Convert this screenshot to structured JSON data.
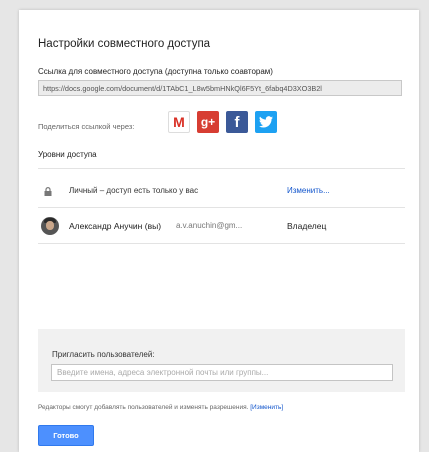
{
  "dialog": {
    "title": "Настройки совместного доступа",
    "link_label": "Ссылка для совместного доступа (доступна только соавторам)",
    "link_value": "https://docs.google.com/document/d/1TAbC1_L8w5bmHNkQl6F5Yt_6fabq4D3XO3B2l",
    "share_via_label": "Поделиться ссылкой через:",
    "share_icons": [
      "gmail-icon",
      "google-plus-icon",
      "facebook-icon",
      "twitter-icon"
    ],
    "access_levels_label": "Уровни доступа",
    "private_text": "Личный – доступ есть только у вас",
    "change_link": "Изменить...",
    "user": {
      "name": "Александр Анучин (вы)",
      "email": "a.v.anuchin@gm...",
      "role": "Владелец"
    },
    "invite": {
      "label": "Пригласить пользователей:",
      "placeholder": "Введите имена, адреса электронной почты или группы..."
    },
    "editors_note": "Редакторы смогут добавлять пользователей и изменять разрешения.",
    "editors_change_link": "[Изменить]",
    "done_button": "Готово"
  },
  "colors": {
    "accent": "#4d90fe",
    "link": "#1155cc",
    "gmail_red": "#d93025",
    "gplus_red": "#d73d32",
    "facebook_blue": "#3b5998",
    "twitter_blue": "#1da1f2"
  }
}
